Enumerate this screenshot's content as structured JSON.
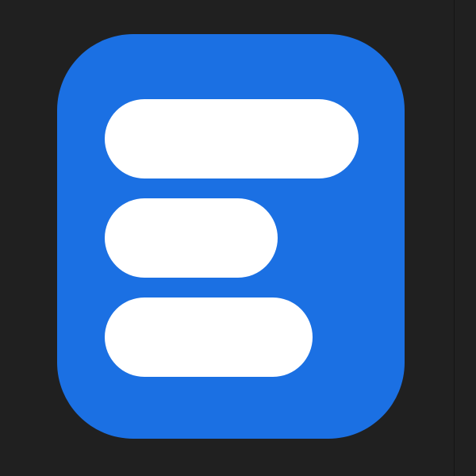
{
  "icon": {
    "name": "list-lines-app-icon",
    "background_color": "#1b70e3",
    "bar_color": "#ffffff"
  },
  "canvas": {
    "background_color": "#202020"
  }
}
